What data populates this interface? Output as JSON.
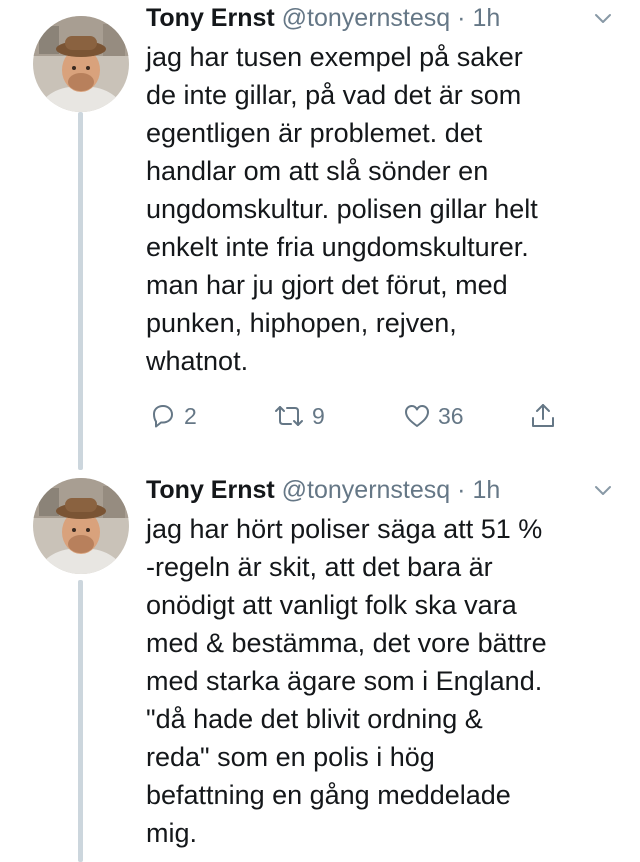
{
  "colors": {
    "text": "#14171a",
    "muted": "#657786",
    "thread_line": "#ccd6dd"
  },
  "tweets": [
    {
      "author_name": "Tony Ernst",
      "handle": "@tonyernstesq",
      "separator": "·",
      "time": "1h",
      "text": "jag har tusen exempel på saker\nde inte gillar, på vad det är som\negentligen är problemet. det\nhandlar om att slå sönder en\nungdomskultur. polisen gillar helt\nenkelt inte fria ungdomskulturer.\nman har ju gjort det förut, med\npunken, hiphopen, rejven,\nwhatnot.",
      "actions": {
        "replies": "2",
        "retweets": "9",
        "likes": "36"
      },
      "icons": [
        "reply-icon",
        "retweet-icon",
        "like-icon",
        "share-icon",
        "chevron-down-icon"
      ]
    },
    {
      "author_name": "Tony Ernst",
      "handle": "@tonyernstesq",
      "separator": "·",
      "time": "1h",
      "text": "jag har hört poliser säga att 51 %\n-regeln är skit, att det bara är\nonödigt att vanligt folk ska vara\nmed & bestämma, det vore bättre\nmed starka ägare som i England.\n\"då hade det blivit ordning &\nreda\" som en polis i hög\nbefattning en gång meddelade\nmig.",
      "icons": [
        "chevron-down-icon"
      ]
    }
  ]
}
